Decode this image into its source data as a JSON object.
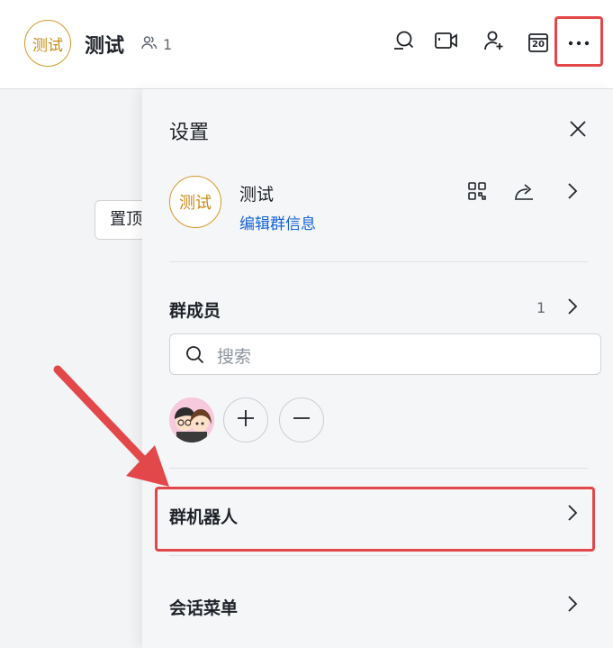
{
  "header": {
    "avatar_text": "测试",
    "title": "测试",
    "member_count": "1",
    "icons": [
      "search-icon",
      "video-icon",
      "add-member-icon",
      "calendar-icon",
      "more-icon"
    ],
    "calendar_day": "20"
  },
  "chat": {
    "pin_label": "置顶"
  },
  "panel": {
    "title": "设置",
    "group": {
      "avatar_text": "测试",
      "name": "测试",
      "edit_link": "编辑群信息"
    },
    "members": {
      "label": "群成员",
      "count": "1",
      "search_placeholder": "搜索"
    },
    "bots": {
      "label": "群机器人"
    },
    "menu": {
      "label": "会话菜单"
    }
  },
  "colors": {
    "highlight": "#e2474a",
    "link": "#1664d9",
    "avatar_border": "#d49a2a"
  }
}
